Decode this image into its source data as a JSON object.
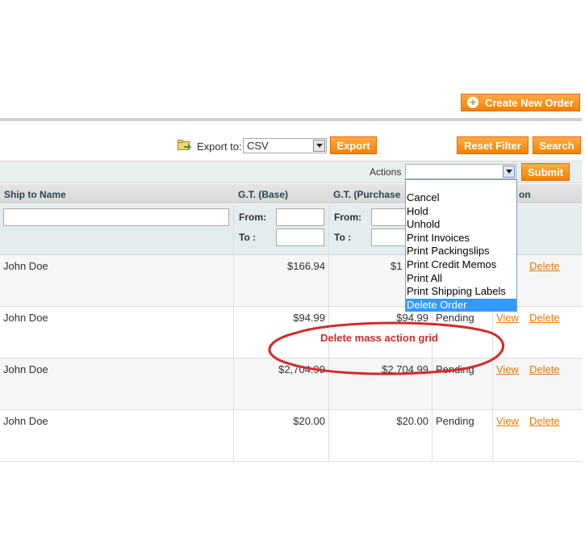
{
  "header": {
    "create_label": "Create New Order"
  },
  "toolbar": {
    "export_label": "Export to:",
    "export_value": "CSV",
    "export_button": "Export",
    "reset_button": "Reset Filter",
    "search_button": "Search"
  },
  "massaction": {
    "label": "Actions",
    "selected": "",
    "submit": "Submit",
    "options": [
      "Cancel",
      "Hold",
      "Unhold",
      "Print Invoices",
      "Print Packingslips",
      "Print Credit Memos",
      "Print All",
      "Print Shipping Labels",
      "Delete Order"
    ],
    "highlighted_option": "Delete Order"
  },
  "grid": {
    "columns": {
      "ship_to": "Ship to Name",
      "gt_base": "G.T. (Base)",
      "gt_purchased": "G.T. (Purchase",
      "action": "on"
    },
    "filter": {
      "from": "From:",
      "to": "To :"
    },
    "rows": [
      {
        "ship_to": "John Doe",
        "gt_base": "$166.94",
        "gt_purchased": "$1",
        "status": "",
        "view": "",
        "delete": "Delete"
      },
      {
        "ship_to": "John Doe",
        "gt_base": "$94.99",
        "gt_purchased": "$94.99",
        "status": "Pending",
        "view": "View",
        "delete": "Delete"
      },
      {
        "ship_to": "John Doe",
        "gt_base": "$2,704.99",
        "gt_purchased": "$2,704.99",
        "status": "Pending",
        "view": "View",
        "delete": "Delete"
      },
      {
        "ship_to": "John Doe",
        "gt_base": "$20.00",
        "gt_purchased": "$20.00",
        "status": "Pending",
        "view": "View",
        "delete": "Delete"
      }
    ]
  },
  "annotation": {
    "text": "Delete mass action grid",
    "color": "#d42a2a"
  },
  "colors": {
    "button": "#f18200",
    "link": "#ea7601",
    "selection": "#3399ff"
  }
}
